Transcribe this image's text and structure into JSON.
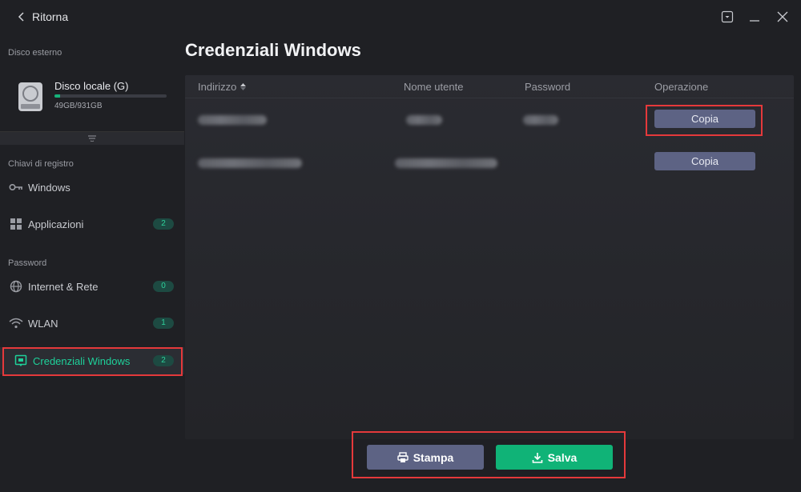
{
  "titlebar": {
    "back_label": "Ritorna"
  },
  "sidebar": {
    "external_disk_label": "Disco esterno",
    "disk": {
      "name": "Disco locale (G)",
      "size_text": "49GB/931GB",
      "used_fraction": 0.053
    },
    "registry_label": "Chiavi di registro",
    "password_label": "Password",
    "items": [
      {
        "label": "Windows",
        "icon": "key-icon"
      },
      {
        "label": "Applicazioni",
        "icon": "grid-icon",
        "badge": "2"
      },
      {
        "label": "Internet & Rete",
        "icon": "globe-icon",
        "badge": "0"
      },
      {
        "label": "WLAN",
        "icon": "wifi-icon",
        "badge": "1"
      },
      {
        "label": "Credenziali Windows",
        "icon": "credential-icon",
        "badge": "2",
        "active": true
      }
    ]
  },
  "main": {
    "title": "Credenziali Windows",
    "columns": [
      "Indirizzo",
      "Nome utente",
      "Password",
      "Operazione"
    ],
    "rows": [
      {
        "action": "Copia"
      },
      {
        "action": "Copia"
      }
    ]
  },
  "footer": {
    "print_label": "Stampa",
    "save_label": "Salva"
  },
  "colors": {
    "accent_green": "#10b377",
    "highlight_red": "#e5393b",
    "button_slate": "#5d6384"
  }
}
